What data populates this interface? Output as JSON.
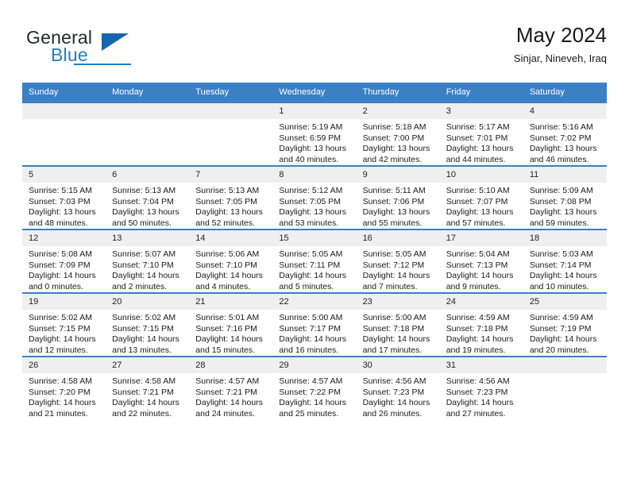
{
  "logo": {
    "word1": "General",
    "word2": "Blue",
    "triangle": "triangle-icon",
    "brand_color": "#1f7fc4"
  },
  "header": {
    "title": "May 2024",
    "subtitle": "Sinjar, Nineveh, Iraq"
  },
  "calendar": {
    "header_bg": "#3b7fc4",
    "daynum_bg": "#efefef",
    "weekdays": [
      "Sunday",
      "Monday",
      "Tuesday",
      "Wednesday",
      "Thursday",
      "Friday",
      "Saturday"
    ],
    "weeks": [
      [
        {
          "day": "",
          "empty": true,
          "sunrise": "",
          "sunset": "",
          "daylight1": "",
          "daylight2": ""
        },
        {
          "day": "",
          "empty": true,
          "sunrise": "",
          "sunset": "",
          "daylight1": "",
          "daylight2": ""
        },
        {
          "day": "",
          "empty": true,
          "sunrise": "",
          "sunset": "",
          "daylight1": "",
          "daylight2": ""
        },
        {
          "day": "1",
          "empty": false,
          "sunrise": "Sunrise: 5:19 AM",
          "sunset": "Sunset: 6:59 PM",
          "daylight1": "Daylight: 13 hours",
          "daylight2": "and 40 minutes."
        },
        {
          "day": "2",
          "empty": false,
          "sunrise": "Sunrise: 5:18 AM",
          "sunset": "Sunset: 7:00 PM",
          "daylight1": "Daylight: 13 hours",
          "daylight2": "and 42 minutes."
        },
        {
          "day": "3",
          "empty": false,
          "sunrise": "Sunrise: 5:17 AM",
          "sunset": "Sunset: 7:01 PM",
          "daylight1": "Daylight: 13 hours",
          "daylight2": "and 44 minutes."
        },
        {
          "day": "4",
          "empty": false,
          "sunrise": "Sunrise: 5:16 AM",
          "sunset": "Sunset: 7:02 PM",
          "daylight1": "Daylight: 13 hours",
          "daylight2": "and 46 minutes."
        }
      ],
      [
        {
          "day": "5",
          "empty": false,
          "sunrise": "Sunrise: 5:15 AM",
          "sunset": "Sunset: 7:03 PM",
          "daylight1": "Daylight: 13 hours",
          "daylight2": "and 48 minutes."
        },
        {
          "day": "6",
          "empty": false,
          "sunrise": "Sunrise: 5:13 AM",
          "sunset": "Sunset: 7:04 PM",
          "daylight1": "Daylight: 13 hours",
          "daylight2": "and 50 minutes."
        },
        {
          "day": "7",
          "empty": false,
          "sunrise": "Sunrise: 5:13 AM",
          "sunset": "Sunset: 7:05 PM",
          "daylight1": "Daylight: 13 hours",
          "daylight2": "and 52 minutes."
        },
        {
          "day": "8",
          "empty": false,
          "sunrise": "Sunrise: 5:12 AM",
          "sunset": "Sunset: 7:05 PM",
          "daylight1": "Daylight: 13 hours",
          "daylight2": "and 53 minutes."
        },
        {
          "day": "9",
          "empty": false,
          "sunrise": "Sunrise: 5:11 AM",
          "sunset": "Sunset: 7:06 PM",
          "daylight1": "Daylight: 13 hours",
          "daylight2": "and 55 minutes."
        },
        {
          "day": "10",
          "empty": false,
          "sunrise": "Sunrise: 5:10 AM",
          "sunset": "Sunset: 7:07 PM",
          "daylight1": "Daylight: 13 hours",
          "daylight2": "and 57 minutes."
        },
        {
          "day": "11",
          "empty": false,
          "sunrise": "Sunrise: 5:09 AM",
          "sunset": "Sunset: 7:08 PM",
          "daylight1": "Daylight: 13 hours",
          "daylight2": "and 59 minutes."
        }
      ],
      [
        {
          "day": "12",
          "empty": false,
          "sunrise": "Sunrise: 5:08 AM",
          "sunset": "Sunset: 7:09 PM",
          "daylight1": "Daylight: 14 hours",
          "daylight2": "and 0 minutes."
        },
        {
          "day": "13",
          "empty": false,
          "sunrise": "Sunrise: 5:07 AM",
          "sunset": "Sunset: 7:10 PM",
          "daylight1": "Daylight: 14 hours",
          "daylight2": "and 2 minutes."
        },
        {
          "day": "14",
          "empty": false,
          "sunrise": "Sunrise: 5:06 AM",
          "sunset": "Sunset: 7:10 PM",
          "daylight1": "Daylight: 14 hours",
          "daylight2": "and 4 minutes."
        },
        {
          "day": "15",
          "empty": false,
          "sunrise": "Sunrise: 5:05 AM",
          "sunset": "Sunset: 7:11 PM",
          "daylight1": "Daylight: 14 hours",
          "daylight2": "and 5 minutes."
        },
        {
          "day": "16",
          "empty": false,
          "sunrise": "Sunrise: 5:05 AM",
          "sunset": "Sunset: 7:12 PM",
          "daylight1": "Daylight: 14 hours",
          "daylight2": "and 7 minutes."
        },
        {
          "day": "17",
          "empty": false,
          "sunrise": "Sunrise: 5:04 AM",
          "sunset": "Sunset: 7:13 PM",
          "daylight1": "Daylight: 14 hours",
          "daylight2": "and 9 minutes."
        },
        {
          "day": "18",
          "empty": false,
          "sunrise": "Sunrise: 5:03 AM",
          "sunset": "Sunset: 7:14 PM",
          "daylight1": "Daylight: 14 hours",
          "daylight2": "and 10 minutes."
        }
      ],
      [
        {
          "day": "19",
          "empty": false,
          "sunrise": "Sunrise: 5:02 AM",
          "sunset": "Sunset: 7:15 PM",
          "daylight1": "Daylight: 14 hours",
          "daylight2": "and 12 minutes."
        },
        {
          "day": "20",
          "empty": false,
          "sunrise": "Sunrise: 5:02 AM",
          "sunset": "Sunset: 7:15 PM",
          "daylight1": "Daylight: 14 hours",
          "daylight2": "and 13 minutes."
        },
        {
          "day": "21",
          "empty": false,
          "sunrise": "Sunrise: 5:01 AM",
          "sunset": "Sunset: 7:16 PM",
          "daylight1": "Daylight: 14 hours",
          "daylight2": "and 15 minutes."
        },
        {
          "day": "22",
          "empty": false,
          "sunrise": "Sunrise: 5:00 AM",
          "sunset": "Sunset: 7:17 PM",
          "daylight1": "Daylight: 14 hours",
          "daylight2": "and 16 minutes."
        },
        {
          "day": "23",
          "empty": false,
          "sunrise": "Sunrise: 5:00 AM",
          "sunset": "Sunset: 7:18 PM",
          "daylight1": "Daylight: 14 hours",
          "daylight2": "and 17 minutes."
        },
        {
          "day": "24",
          "empty": false,
          "sunrise": "Sunrise: 4:59 AM",
          "sunset": "Sunset: 7:18 PM",
          "daylight1": "Daylight: 14 hours",
          "daylight2": "and 19 minutes."
        },
        {
          "day": "25",
          "empty": false,
          "sunrise": "Sunrise: 4:59 AM",
          "sunset": "Sunset: 7:19 PM",
          "daylight1": "Daylight: 14 hours",
          "daylight2": "and 20 minutes."
        }
      ],
      [
        {
          "day": "26",
          "empty": false,
          "sunrise": "Sunrise: 4:58 AM",
          "sunset": "Sunset: 7:20 PM",
          "daylight1": "Daylight: 14 hours",
          "daylight2": "and 21 minutes."
        },
        {
          "day": "27",
          "empty": false,
          "sunrise": "Sunrise: 4:58 AM",
          "sunset": "Sunset: 7:21 PM",
          "daylight1": "Daylight: 14 hours",
          "daylight2": "and 22 minutes."
        },
        {
          "day": "28",
          "empty": false,
          "sunrise": "Sunrise: 4:57 AM",
          "sunset": "Sunset: 7:21 PM",
          "daylight1": "Daylight: 14 hours",
          "daylight2": "and 24 minutes."
        },
        {
          "day": "29",
          "empty": false,
          "sunrise": "Sunrise: 4:57 AM",
          "sunset": "Sunset: 7:22 PM",
          "daylight1": "Daylight: 14 hours",
          "daylight2": "and 25 minutes."
        },
        {
          "day": "30",
          "empty": false,
          "sunrise": "Sunrise: 4:56 AM",
          "sunset": "Sunset: 7:23 PM",
          "daylight1": "Daylight: 14 hours",
          "daylight2": "and 26 minutes."
        },
        {
          "day": "31",
          "empty": false,
          "sunrise": "Sunrise: 4:56 AM",
          "sunset": "Sunset: 7:23 PM",
          "daylight1": "Daylight: 14 hours",
          "daylight2": "and 27 minutes."
        },
        {
          "day": "",
          "empty": true,
          "sunrise": "",
          "sunset": "",
          "daylight1": "",
          "daylight2": ""
        }
      ]
    ]
  }
}
